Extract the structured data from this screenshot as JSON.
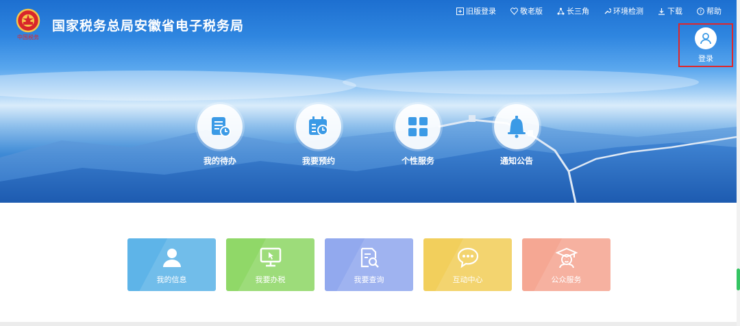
{
  "header": {
    "title": "国家税务总局安徽省电子税务局",
    "emblem_caption": "中国税务"
  },
  "topnav": [
    {
      "icon": "old-version-icon",
      "label": "旧版登录"
    },
    {
      "icon": "elderly-icon",
      "label": "敬老版"
    },
    {
      "icon": "triangle-icon",
      "label": "长三角"
    },
    {
      "icon": "wrench-icon",
      "label": "环境检测"
    },
    {
      "icon": "download-icon",
      "label": "下载"
    },
    {
      "icon": "help-icon",
      "label": "帮助"
    }
  ],
  "login": {
    "label": "登录",
    "icon": "user-icon"
  },
  "quick_actions": [
    {
      "icon": "todo-icon",
      "label": "我的待办"
    },
    {
      "icon": "calendar-icon",
      "label": "我要预约"
    },
    {
      "icon": "grid-icon",
      "label": "个性服务"
    },
    {
      "icon": "bell-icon",
      "label": "通知公告"
    }
  ],
  "tiles": [
    {
      "icon": "user-icon",
      "label": "我的信息",
      "color": "#5eb4e8"
    },
    {
      "icon": "monitor-icon",
      "label": "我要办税",
      "color": "#90d868"
    },
    {
      "icon": "search-doc-icon",
      "label": "我要查询",
      "color": "#92a9ee"
    },
    {
      "icon": "chat-icon",
      "label": "互动中心",
      "color": "#f2cf5c"
    },
    {
      "icon": "graduate-icon",
      "label": "公众服务",
      "color": "#f5a793"
    }
  ],
  "colors": {
    "accent": "#3b9ae6",
    "highlight": "#e0262a"
  }
}
